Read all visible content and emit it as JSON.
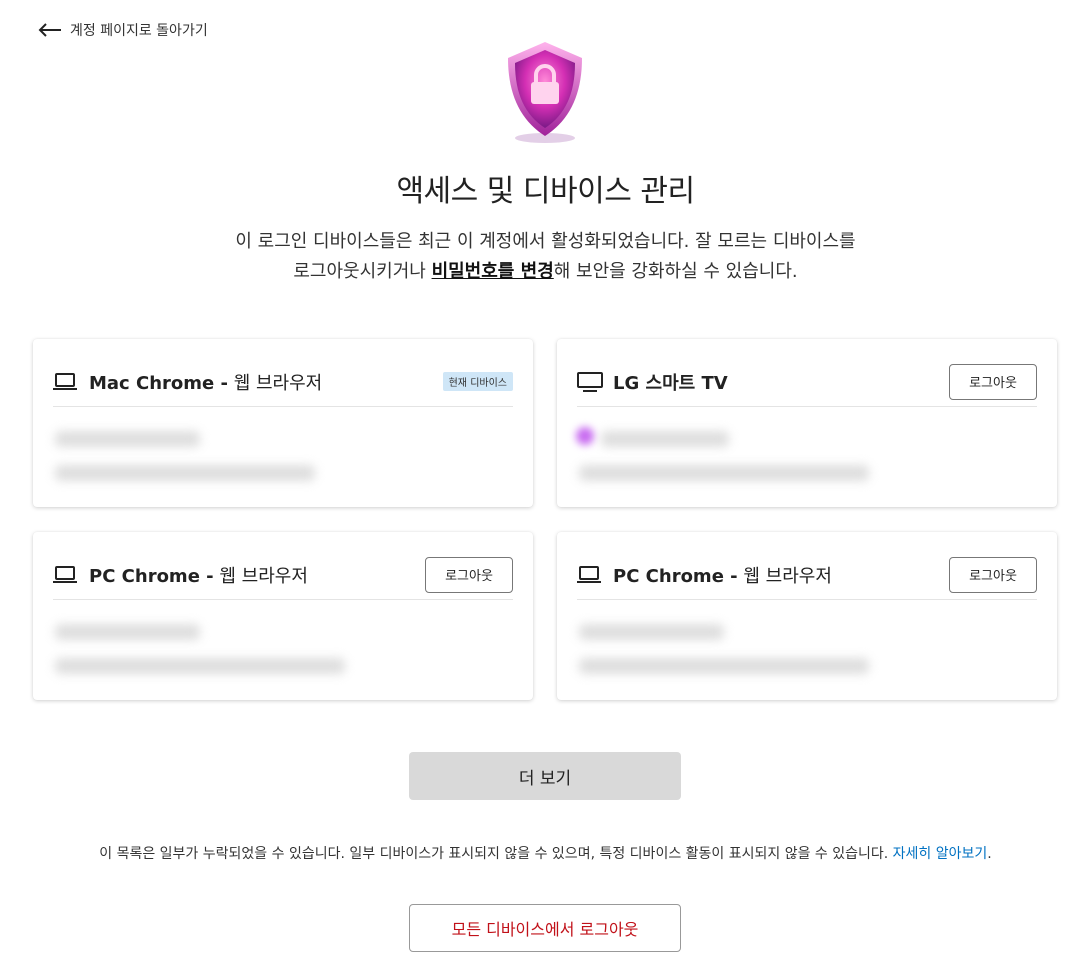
{
  "nav": {
    "back_label": "계정 페이지로 돌아가기"
  },
  "page": {
    "title": "액세스 및 디바이스 관리",
    "subtitle_line1": "이 로그인 디바이스들은 최근 이 계정에서 활성화되었습니다. 잘 모르는 디바이스를",
    "subtitle_line2_before": "로그아웃시키거나 ",
    "subtitle_link": "비밀번호를 변경",
    "subtitle_line2_after": "해 보안을 강화하실 수 있습니다."
  },
  "devices": [
    {
      "name_strong": "Mac Chrome -",
      "name_rest": " 웹 브라우저",
      "badge": "현재 디바이스",
      "icon": "laptop-icon"
    },
    {
      "name_strong": "LG 스마트 TV",
      "name_rest": "",
      "logout_label": "로그아웃",
      "icon": "tv-icon"
    },
    {
      "name_strong": "PC Chrome -",
      "name_rest": " 웹 브라우저",
      "logout_label": "로그아웃",
      "icon": "laptop-icon"
    },
    {
      "name_strong": "PC Chrome -",
      "name_rest": " 웹 브라우저",
      "logout_label": "로그아웃",
      "icon": "laptop-icon"
    }
  ],
  "more_label": "더 보기",
  "notice": {
    "text": "이 목록은 일부가 누락되었을 수 있습니다. 일부 디바이스가 표시되지 않을 수 있으며, 특정 디바이스 활동이 표시되지 않을 수 있습니다. ",
    "link": "자세히 알아보기",
    "end": "."
  },
  "logout_all_label": "모든 디바이스에서 로그아웃",
  "colors": {
    "accent_link": "#0071c2",
    "danger": "#c11119",
    "badge_bg": "#cfe6f7"
  }
}
